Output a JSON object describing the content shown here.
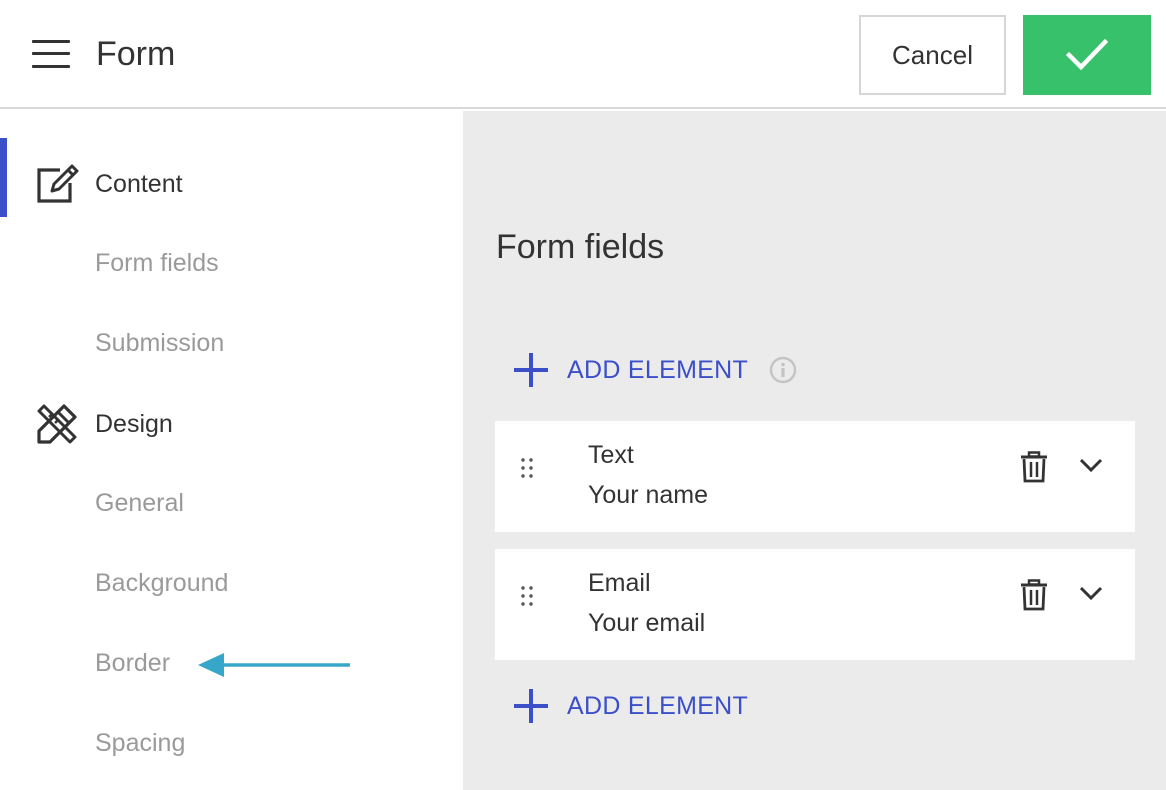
{
  "header": {
    "title": "Form",
    "cancel_label": "Cancel",
    "menu_icon": "hamburger-icon",
    "confirm_icon": "checkmark-icon"
  },
  "sidebar": {
    "sections": [
      {
        "label": "Content",
        "icon": "edit-icon",
        "items": [
          "Form fields",
          "Submission"
        ]
      },
      {
        "label": "Design",
        "icon": "design-pencil-ruler-icon",
        "items": [
          "General",
          "Background",
          "Border",
          "Spacing"
        ]
      }
    ]
  },
  "main": {
    "title": "Form fields",
    "add_element_label": "ADD ELEMENT",
    "fields": [
      {
        "type": "Text",
        "label": "Your name"
      },
      {
        "type": "Email",
        "label": "Your email"
      }
    ]
  },
  "colors": {
    "accent": "#3b4fc8",
    "confirm": "#37c16b",
    "arrow": "#36a6c9",
    "panel_bg": "#ebebeb"
  }
}
